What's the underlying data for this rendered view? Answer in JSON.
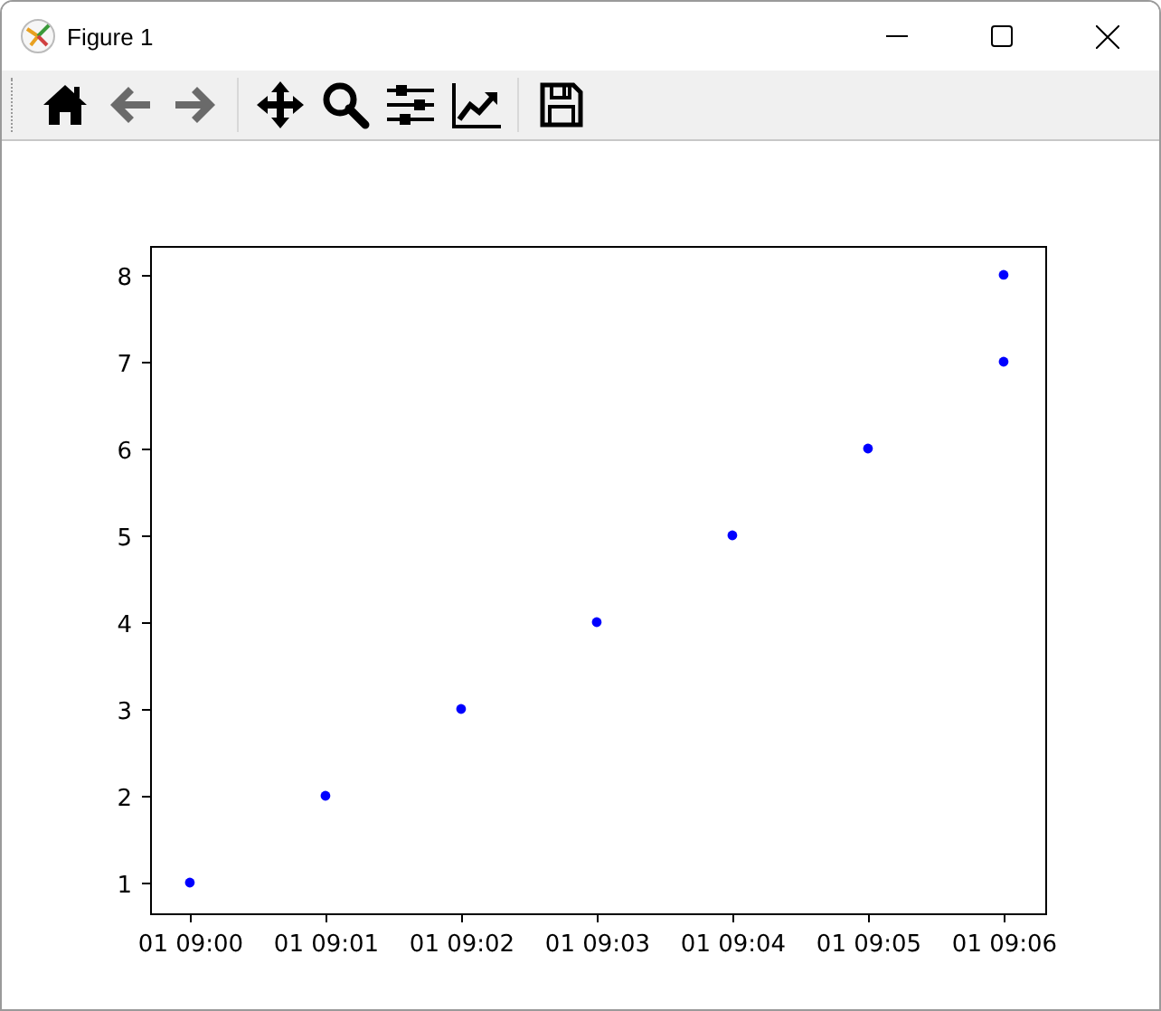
{
  "window": {
    "title": "Figure 1"
  },
  "toolbar": [
    {
      "kind": "home",
      "disabled": false
    },
    {
      "kind": "back",
      "disabled": true
    },
    {
      "kind": "forward",
      "disabled": true
    },
    {
      "kind": "separator"
    },
    {
      "kind": "pan",
      "disabled": false
    },
    {
      "kind": "zoom",
      "disabled": false
    },
    {
      "kind": "subplots",
      "disabled": false
    },
    {
      "kind": "axes",
      "disabled": false
    },
    {
      "kind": "separator"
    },
    {
      "kind": "save",
      "disabled": false
    }
  ],
  "figure": {
    "chart_data": {
      "type": "scatter",
      "categories": [
        "01 09:00",
        "01 09:01",
        "01 09:02",
        "01 09:03",
        "01 09:04",
        "01 09:05",
        "01 09:06"
      ],
      "series": [
        {
          "color": "#0000ff",
          "values": [
            1,
            2,
            3,
            4,
            5,
            6,
            7
          ]
        },
        {
          "color": "#0000ff",
          "values": [
            null,
            null,
            null,
            null,
            null,
            null,
            8
          ]
        }
      ],
      "ylim": [
        0.646,
        8.333
      ],
      "yticks": [
        1,
        2,
        3,
        4,
        5,
        6,
        7,
        8
      ]
    }
  }
}
